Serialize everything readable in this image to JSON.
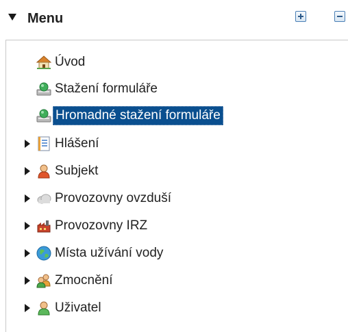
{
  "header": {
    "title": "Menu",
    "expand_icon": "plus-square-icon",
    "collapse_icon": "minus-square-icon"
  },
  "tree": {
    "items": [
      {
        "label": "Úvod",
        "icon": "home-icon",
        "expandable": false,
        "selected": false
      },
      {
        "label": "Stažení formuláře",
        "icon": "download-form-icon",
        "expandable": false,
        "selected": false
      },
      {
        "label": "Hromadné stažení formuláře",
        "icon": "download-form-icon",
        "expandable": false,
        "selected": true
      },
      {
        "label": "Hlášení",
        "icon": "report-icon",
        "expandable": true,
        "selected": false
      },
      {
        "label": "Subjekt",
        "icon": "person-icon",
        "expandable": true,
        "selected": false
      },
      {
        "label": "Provozovny ovzduší",
        "icon": "cloud-icon",
        "expandable": true,
        "selected": false
      },
      {
        "label": "Provozovny IRZ",
        "icon": "factory-icon",
        "expandable": true,
        "selected": false
      },
      {
        "label": "Místa užívání vody",
        "icon": "globe-icon",
        "expandable": true,
        "selected": false
      },
      {
        "label": "Zmocnění",
        "icon": "people-icon",
        "expandable": true,
        "selected": false
      },
      {
        "label": "Uživatel",
        "icon": "user-icon",
        "expandable": true,
        "selected": false
      }
    ]
  },
  "colors": {
    "selection_bg": "#0a4f8f",
    "selection_text": "#ffffff",
    "text": "#222222"
  }
}
